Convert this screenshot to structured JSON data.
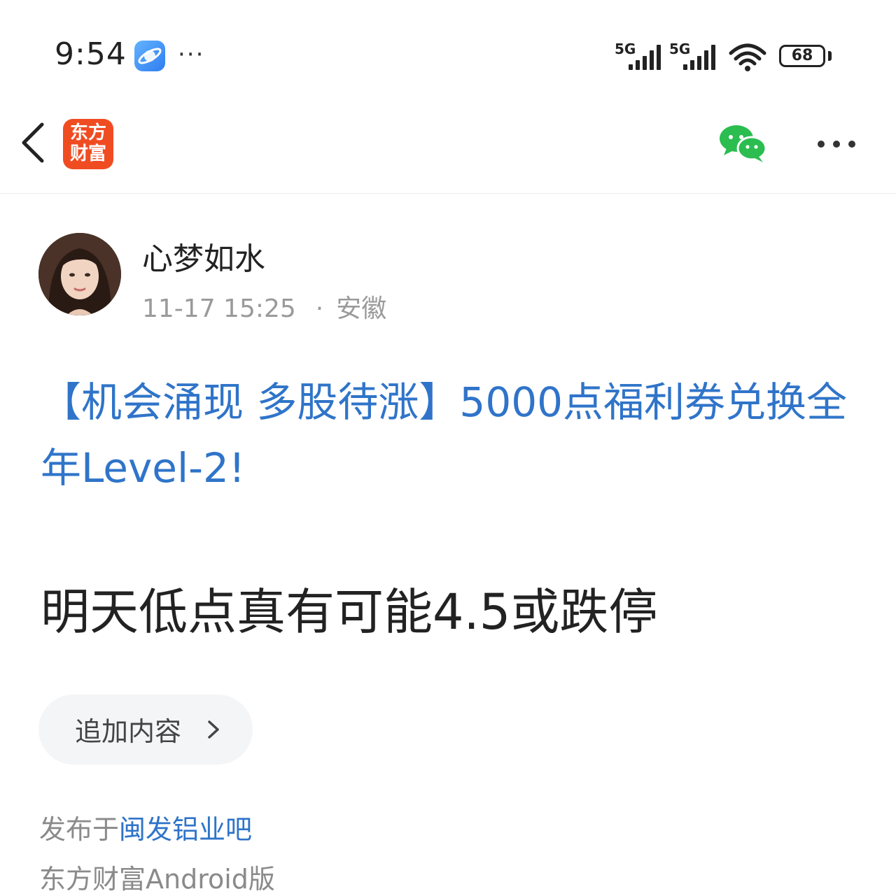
{
  "status_bar": {
    "time": "9:54",
    "more_dots": "···",
    "signal_1_label": "5G",
    "signal_2_label": "5G",
    "battery": "68"
  },
  "nav": {
    "logo_line1": "东方",
    "logo_line2": "财富"
  },
  "author": {
    "name": "心梦如水",
    "date": "11-17 15:25",
    "separator": "·",
    "location": "安徽"
  },
  "promo_text": "【机会涌现 多股待涨】5000点福利券兑换全年Level-2!",
  "post_body": "明天低点真有可能4.5或跌停",
  "append_button": "追加内容",
  "footer": {
    "published_prefix": "发布于",
    "forum_name": "闽发铝业吧",
    "source": "东方财富Android版"
  },
  "colors": {
    "link_blue": "#2f74c9",
    "brand_orange": "#f04c22",
    "wechat_green": "#2bbd4f"
  },
  "icons": [
    "back-chevron-icon",
    "browser-app-icon",
    "wechat-icon",
    "more-horizontal-icon",
    "chevron-right-icon"
  ]
}
